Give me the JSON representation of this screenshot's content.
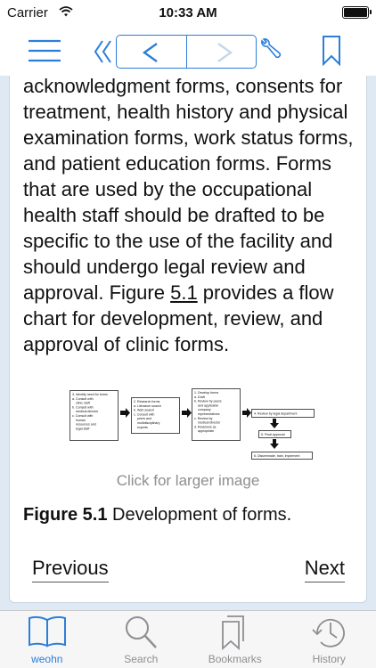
{
  "status_bar": {
    "carrier": "Carrier",
    "time": "10:33 AM"
  },
  "toolbar": {
    "icons": [
      "menu-icon",
      "first-page-icon",
      "back-icon",
      "forward-icon",
      "wrench-icon",
      "bookmark-icon"
    ]
  },
  "content": {
    "paragraph_before_ref": "acknowledgment forms, consents for treatment, health history and physical examination forms, work status forms, and patient education forms. Forms that are used by the occupational health staff should be drafted to be specific to the use of the facility and should undergo legal review and approval. Figure ",
    "figure_ref": "5.1",
    "paragraph_after_ref": " provides a flow chart for development, review, and approval of clinic forms.",
    "figure_note": "Click for larger image",
    "caption_label": "Figure 5.1",
    "caption_text": " Development of forms.",
    "prev_label": "Previous",
    "next_label": "Next"
  },
  "flowchart": {
    "box1": [
      "3. Identify need for forms",
      "a. Consult with",
      "clinic staff",
      "b. Consult with",
      "medical director",
      "c. Consult with",
      "human",
      "resources and",
      "legal staff"
    ],
    "box2": [
      "2. Research forms",
      "a. Literature search",
      "b. Web search",
      "c. Consult with",
      "peers and",
      "multidisciplinary",
      "experts"
    ],
    "box3": [
      "1. Develop forms",
      "a. Draft",
      "b. Review by peers",
      "and applicable",
      "company",
      "representatives",
      "c. Review by",
      "medical director",
      "d. Revisions as",
      "appropriate"
    ],
    "box4": "4. Review by legal department",
    "box5": "5. Final approval",
    "box6": "6. Disseminate, train, implement"
  },
  "tabs": [
    {
      "label": "weohn",
      "icon": "book-icon",
      "active": true
    },
    {
      "label": "Search",
      "icon": "search-icon",
      "active": false
    },
    {
      "label": "Bookmarks",
      "icon": "bookmarks-icon",
      "active": false
    },
    {
      "label": "History",
      "icon": "history-icon",
      "active": false
    }
  ],
  "colors": {
    "accent": "#2b7fd9",
    "background": "#dfe9f3",
    "inactive": "#8e8e93"
  }
}
